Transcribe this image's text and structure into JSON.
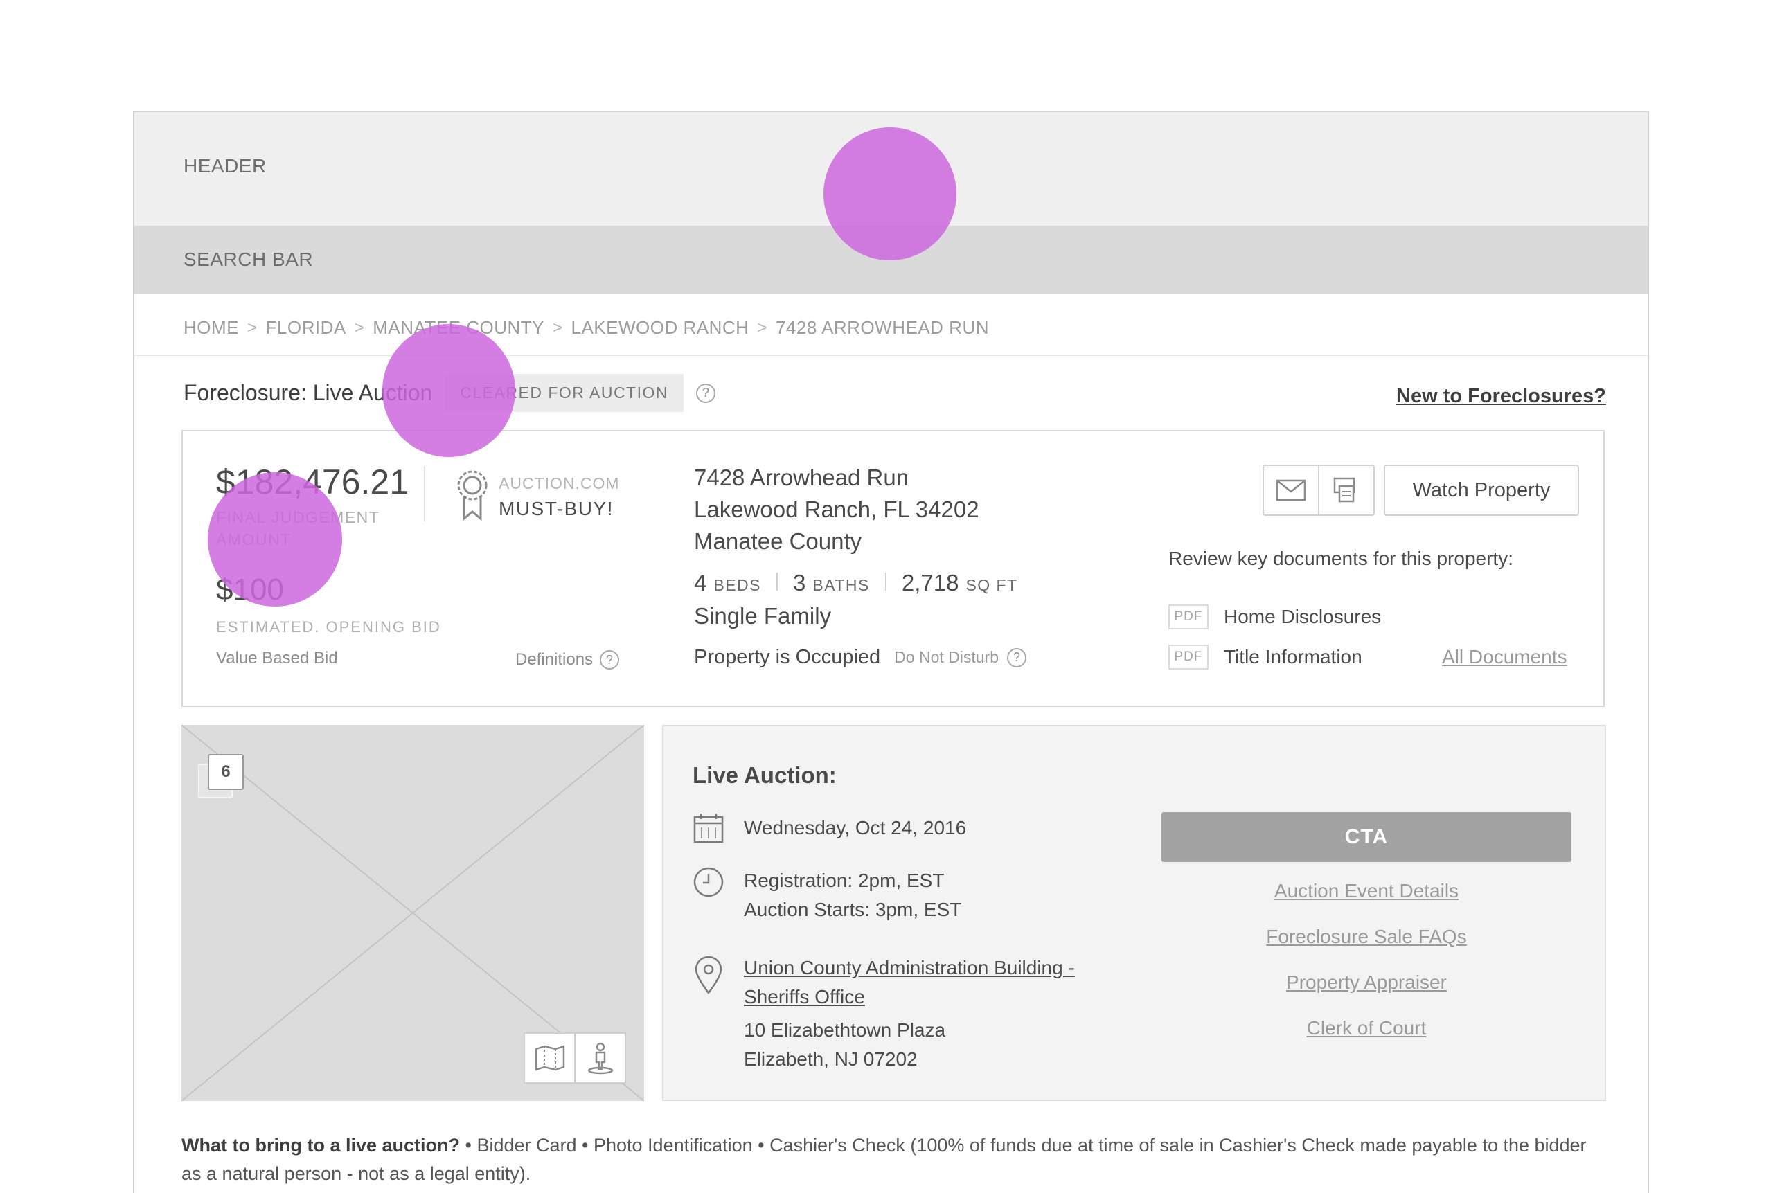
{
  "header": {
    "label": "HEADER"
  },
  "search_bar": {
    "label": "SEARCH BAR"
  },
  "breadcrumb": [
    "HOME",
    "FLORIDA",
    "MANATEE COUNTY",
    "LAKEWOOD RANCH",
    "7428 ARROWHEAD RUN"
  ],
  "breadcrumb_separator": ">",
  "status": {
    "title": "Foreclosure: Live Auction",
    "badge": "CLEARED FOR AUCTION",
    "help": "?",
    "new_link": "New to Foreclosures?"
  },
  "pricing": {
    "final_judgement": "$182,476.21",
    "final_judgement_label": "FINAL JUDGEMENT AMOUNT",
    "must_buy_top": "AUCTION.COM",
    "must_buy_bottom": "MUST-BUY!",
    "opening_bid": "$100",
    "opening_bid_label": "ESTIMATED. OPENING BID",
    "value_based": "Value Based Bid",
    "definitions": "Definitions"
  },
  "property": {
    "address_line1": "7428 Arrowhead Run",
    "address_line2": "Lakewood Ranch, FL 34202",
    "county": "Manatee County",
    "beds": "4",
    "beds_unit": "BEDS",
    "baths": "3",
    "baths_unit": "BATHS",
    "sqft": "2,718",
    "sqft_unit": "SQ FT",
    "type": "Single Family",
    "occupancy": "Property is Occupied",
    "do_not_disturb": "Do Not Disturb"
  },
  "actions": {
    "email_icon": "envelope-icon",
    "print_icon": "print-icon",
    "watch_label": "Watch Property"
  },
  "documents": {
    "intro": "Review key documents for this property:",
    "items": [
      {
        "tag": "PDF",
        "name": "Home Disclosures"
      },
      {
        "tag": "PDF",
        "name": "Title Information"
      }
    ],
    "all_link": "All Documents"
  },
  "photo": {
    "count": "6"
  },
  "auction": {
    "title": "Live Auction:",
    "date": "Wednesday, Oct 24, 2016",
    "registration": "Registration:  2pm, EST",
    "start": "Auction Starts:  3pm, EST",
    "venue_line1": "Union County Administration Building -",
    "venue_line2": "Sheriffs Office",
    "street": "10 Elizabethtown Plaza",
    "city": "Elizabeth, NJ 07202",
    "cta": "CTA",
    "links": [
      "Auction Event Details",
      "Foreclosure Sale FAQs",
      "Property Appraiser",
      "Clerk of Court"
    ]
  },
  "bring": {
    "question": "What to bring to a live auction?",
    "items": "• Bidder Card   • Photo Identification   • Cashier's Check (100% of funds due at time of sale in Cashier's Check made payable to the bidder as a natural person - not as a legal entity)."
  },
  "colors": {
    "marker": "#cc66dd",
    "cta_bg": "#a3a3a3",
    "header_bg": "#efefef",
    "search_bg": "#dadada"
  }
}
